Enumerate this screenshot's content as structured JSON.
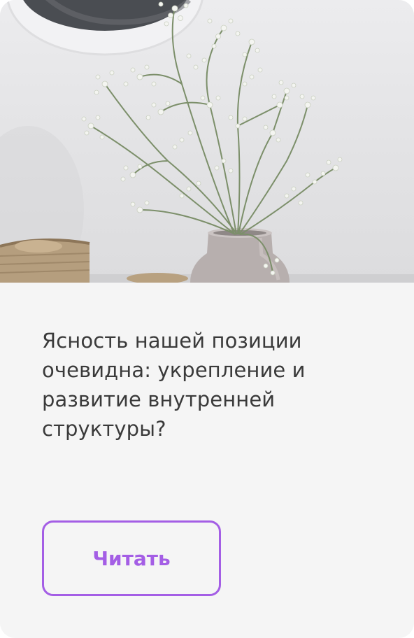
{
  "card": {
    "title": "Ясность нашей позиции очевидна: укрепление и развитие внутренней структуры?",
    "read_button_label": "Читать"
  },
  "colors": {
    "accent": "#a45ee5",
    "text": "#3a3a3a",
    "card_background": "#f5f5f5"
  }
}
